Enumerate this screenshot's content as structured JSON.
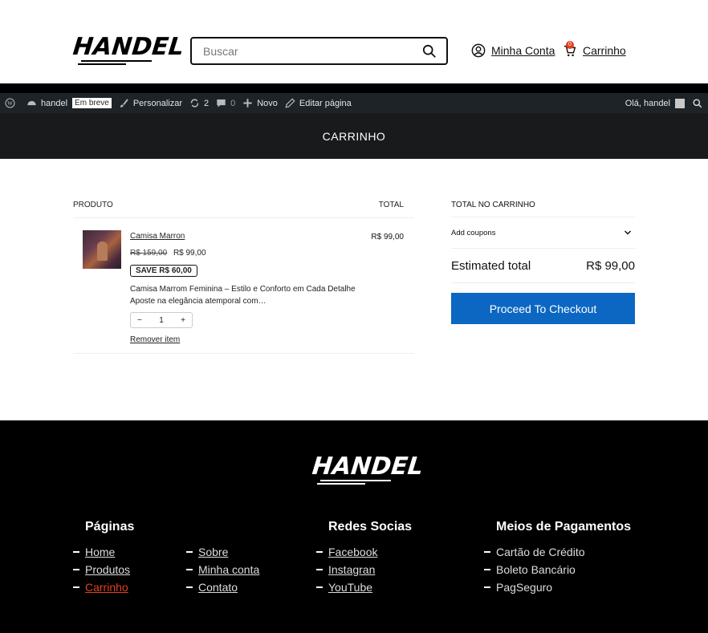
{
  "header": {
    "logo_text": "HANDEL",
    "search_placeholder": "Buscar",
    "account_label": "Minha Conta",
    "cart_label": "Carrinho",
    "cart_count": "0"
  },
  "admin_bar": {
    "site_name": "handel",
    "status_tag": "Em breve",
    "customize": "Personalizar",
    "updates": "2",
    "comments": "0",
    "new": "Novo",
    "edit_page": "Editar página",
    "greeting": "Olá, handel"
  },
  "page_title": "CARRINHO",
  "cart": {
    "col_product": "PRODUTO",
    "col_total": "TOTAL",
    "item": {
      "name": "Camisa Marron",
      "old_price": "R$ 159,00",
      "price": "R$ 99,00",
      "save_badge": "SAVE R$ 60,00",
      "description_line1": "Camisa Marrom Feminina – Estilo e Conforto em Cada Detalhe",
      "description_line2": "Aposte na elegância atemporal com…",
      "quantity": "1",
      "minus": "−",
      "plus": "+",
      "remove": "Remover item",
      "line_total": "R$ 99,00"
    }
  },
  "totals": {
    "heading": "TOTAL NO CARRINHO",
    "coupons": "Add coupons",
    "estimated_label": "Estimated total",
    "estimated_value": "R$ 99,00",
    "checkout": "Proceed To Checkout"
  },
  "footer": {
    "logo_text": "HANDEL",
    "pages_heading": "Páginas",
    "pages_col1": [
      "Home",
      "Produtos",
      "Carrinho"
    ],
    "pages_col2": [
      "Sobre",
      "Minha conta",
      "Contato"
    ],
    "social_heading": "Redes Socias",
    "social": [
      "Facebook",
      "Instagran",
      "YouTube"
    ],
    "payments_heading": "Meios de Pagamentos",
    "payments": [
      "Cartão de Crédito",
      "Boleto Bancário",
      "PagSeguro"
    ]
  },
  "colors": {
    "accent_blue": "#0b67c2",
    "active_link": "#e2401c",
    "admin_bar": "#1d2327"
  }
}
